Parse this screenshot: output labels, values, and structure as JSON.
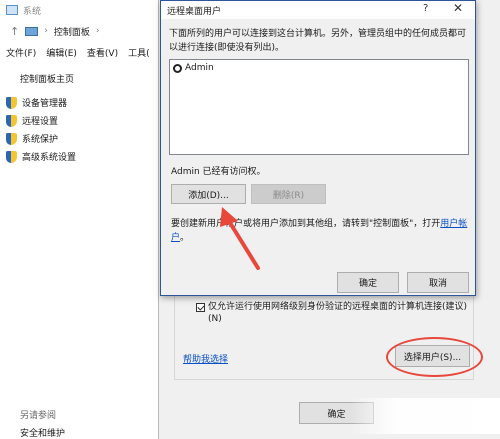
{
  "background_window": {
    "title": "系统",
    "address": {
      "separator": "›",
      "crumb": "控制面板",
      "crumb_sep": "›"
    },
    "menu": [
      "文件(F)",
      "编辑(E)",
      "查看(V)",
      "工具("
    ],
    "left_panel": {
      "home": "控制面板主页",
      "links": [
        "设备管理器",
        "远程设置",
        "系统保护",
        "高级系统设置"
      ],
      "see_also": "另请参阅",
      "security": "安全和维护"
    }
  },
  "system_properties": {
    "nla_option": "仅允许运行使用网络级别身份验证的远程桌面的计算机连接(建议)\n(N)",
    "help_link": "帮助我选择",
    "select_users_button": "选择用户(S)...",
    "ok_button": "确定"
  },
  "dialog": {
    "title": "远程桌面用户",
    "help": "?",
    "close": "✕",
    "description": "下面所列的用户可以连接到这台计算机。另外，管理员组中的任何成员都可以进行连接(即使没有列出)。",
    "users": [
      "Admin"
    ],
    "access_note": "Admin 已经有访问权。",
    "add_button": "添加(D)...",
    "delete_button": "删除(R)",
    "create_text": "要创建新用户帐户或将用户添加到其他组，请转到\"控制面板\"，打开",
    "create_link": "用户帐户",
    "create_tail": "。",
    "ok_button": "确定",
    "cancel_button": "取消"
  },
  "colors": {
    "annotation": "#e8473c",
    "link": "#0a4fc7",
    "dialog_border": "#2b579a"
  }
}
